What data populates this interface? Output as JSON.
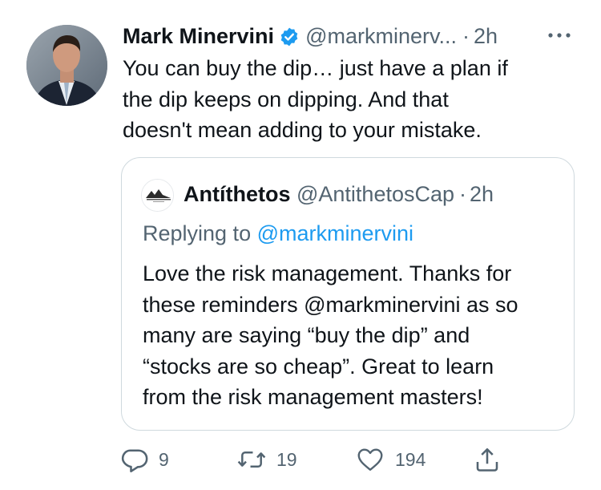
{
  "author": {
    "name": "Mark Minervini",
    "handle": "@markminerv...",
    "separator": "·",
    "time": "2h"
  },
  "tweet": {
    "text": "You can buy the dip… just have a plan if\nthe dip keeps on dipping.  And that\ndoesn't mean adding to your mistake."
  },
  "quoted": {
    "name": "Antíthetos",
    "handle": "@AntithetosCap",
    "separator": "·",
    "time": "2h",
    "replying_prefix": "Replying to ",
    "replying_to": "@markminervini",
    "text": "Love the risk management. Thanks for\nthese reminders @markminervini as so\nmany are saying “buy the dip” and\n“stocks are so cheap”. Great to learn\nfrom the risk management masters!"
  },
  "actions": {
    "replies": "9",
    "retweets": "19",
    "likes": "194"
  },
  "icons": {
    "verified": "verified-badge-icon",
    "more": "more-horizontal-icon",
    "reply": "reply-icon",
    "retweet": "retweet-icon",
    "like": "heart-icon",
    "share": "share-icon"
  },
  "colors": {
    "text": "#0f1419",
    "secondary": "#536471",
    "accent": "#1d9bf0",
    "border": "#cfd9de"
  }
}
